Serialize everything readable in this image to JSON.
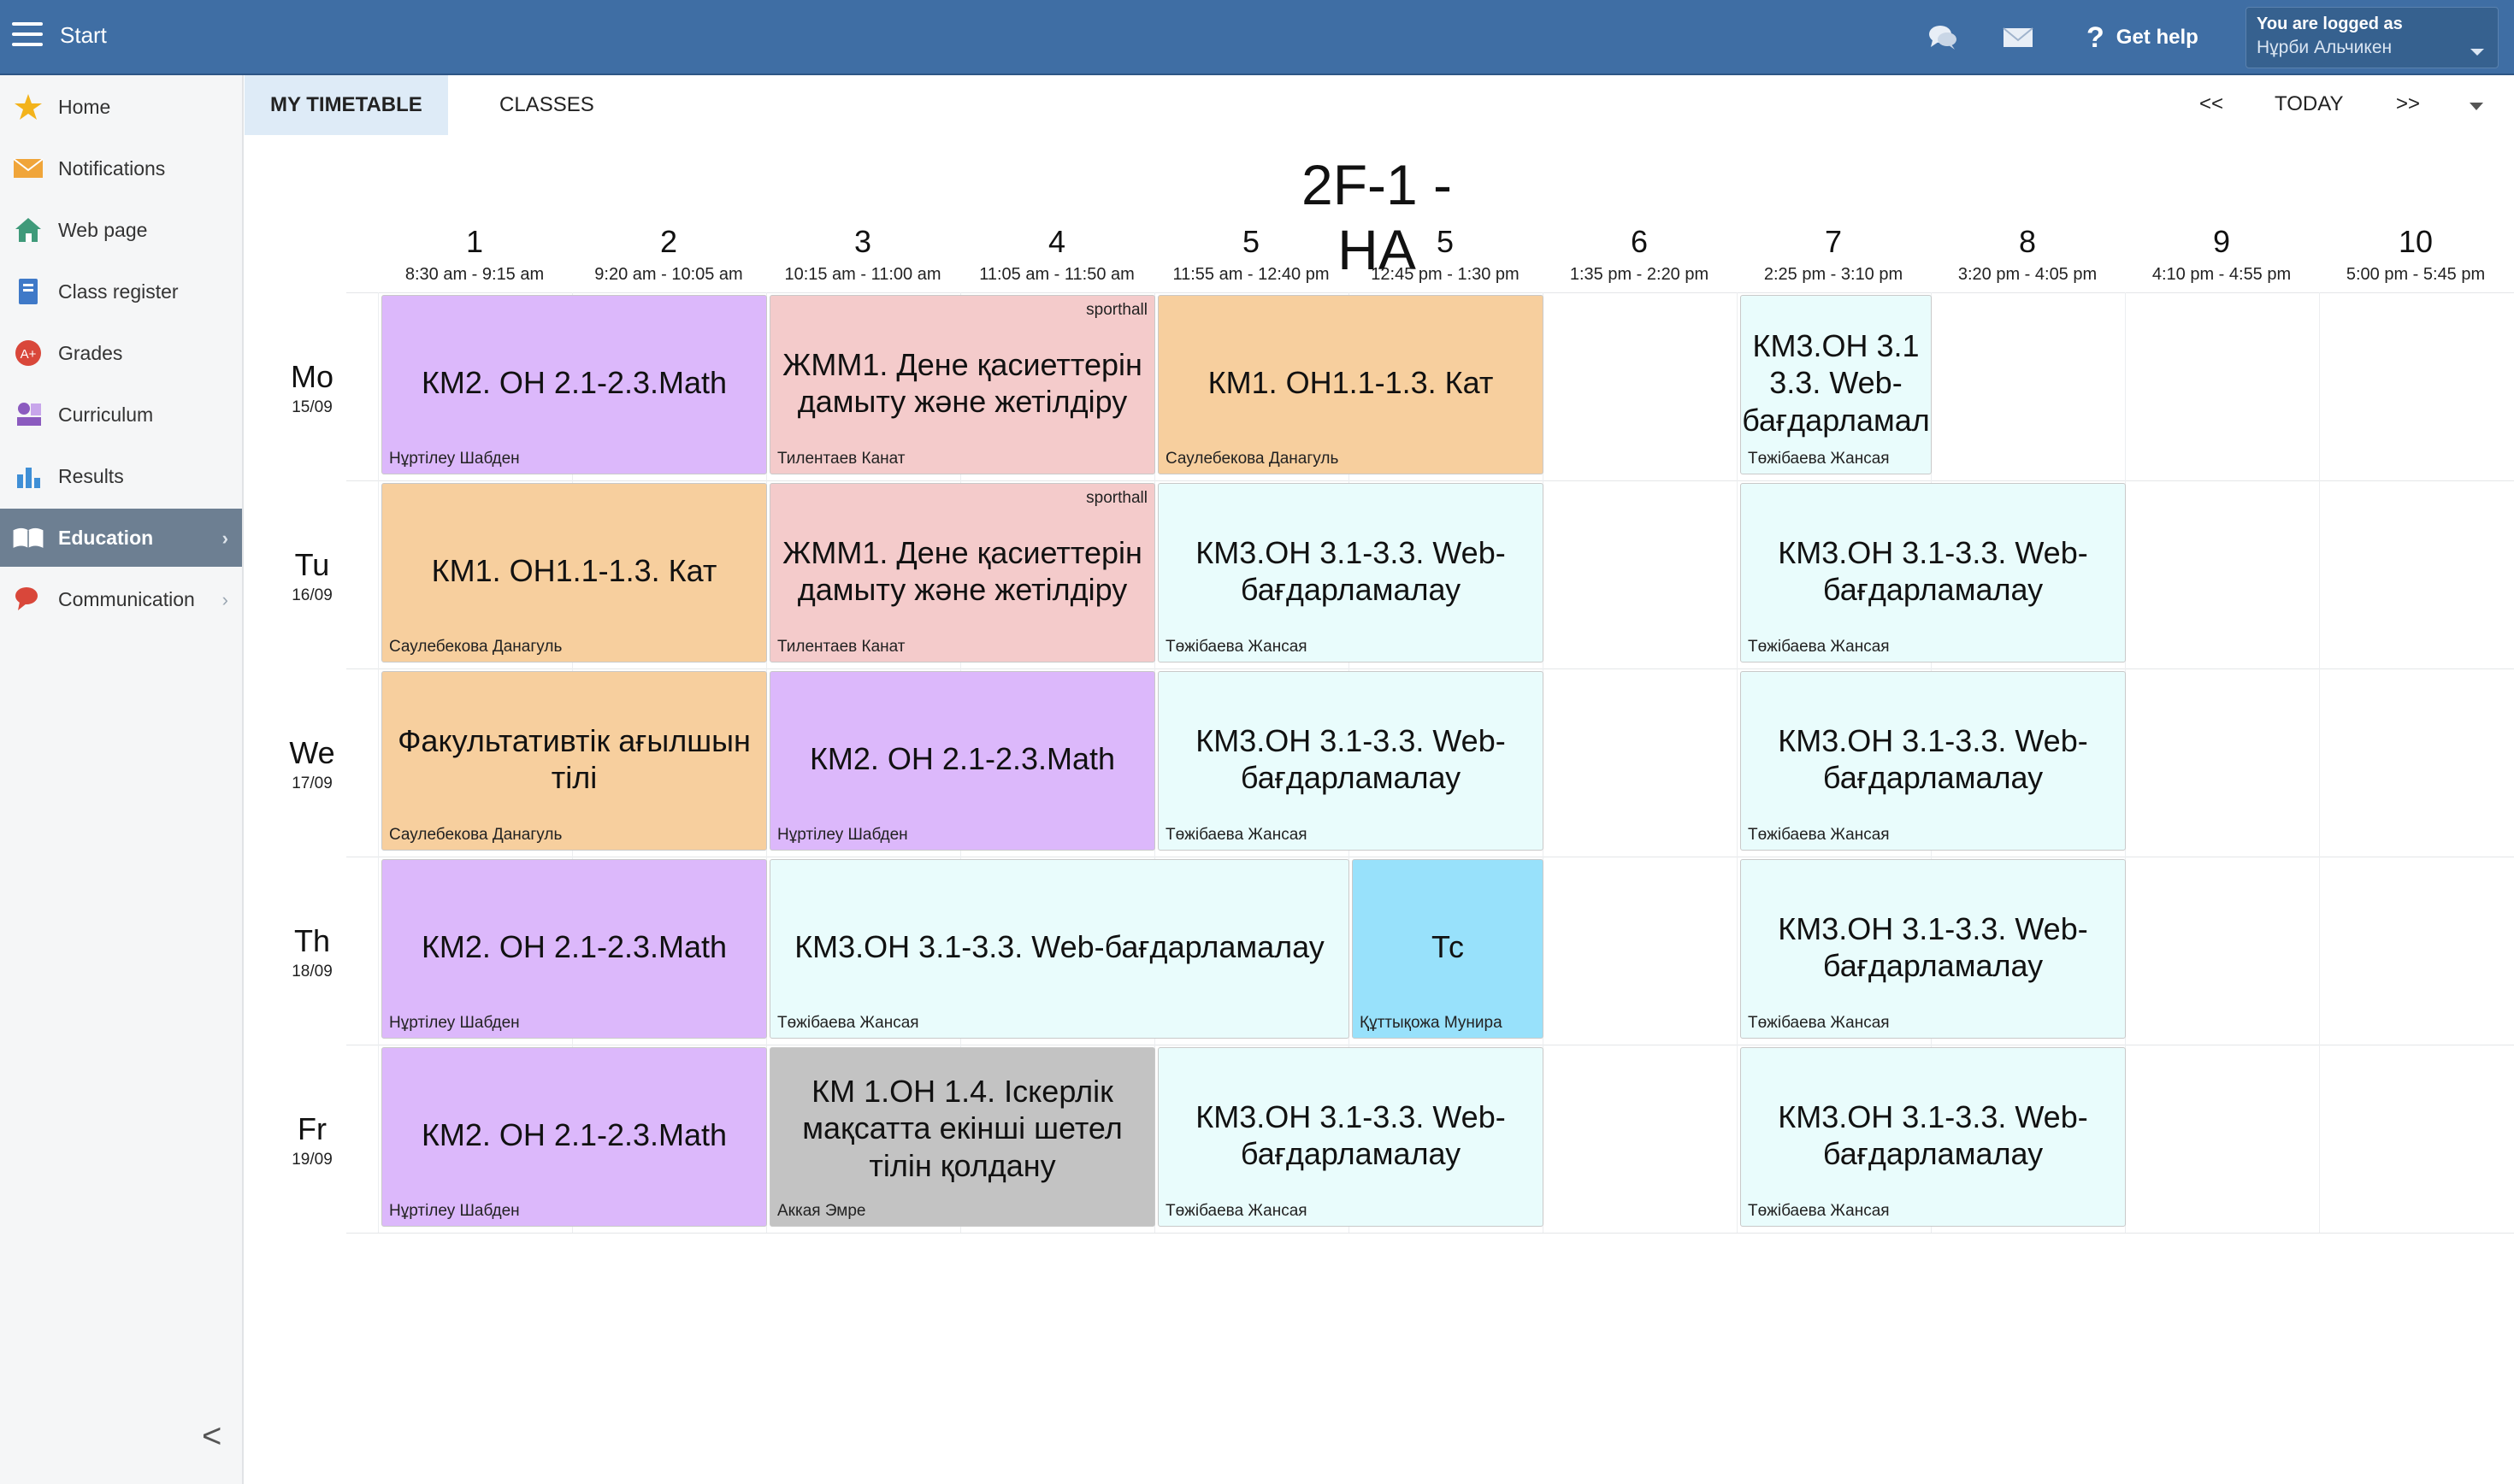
{
  "app": {
    "title": "Start"
  },
  "header": {
    "get_help": "Get help",
    "user_label": "You are logged as",
    "user_name": "Нұрби Альчикен",
    "icons": [
      "chat-icon",
      "mail-icon",
      "help-icon"
    ],
    "accent_color": "#3f6ea4"
  },
  "sidebar": {
    "items": [
      {
        "label": "Home",
        "icon": "star-icon"
      },
      {
        "label": "Notifications",
        "icon": "envelope-icon"
      },
      {
        "label": "Web page",
        "icon": "house-icon"
      },
      {
        "label": "Class register",
        "icon": "register-icon"
      },
      {
        "label": "Grades",
        "icon": "grades-icon"
      },
      {
        "label": "Curriculum",
        "icon": "curriculum-icon"
      },
      {
        "label": "Results",
        "icon": "bar-chart-icon"
      },
      {
        "label": "Education",
        "icon": "book-icon"
      },
      {
        "label": "Communication",
        "icon": "speech-bubble-icon"
      }
    ],
    "active": "Education",
    "collapse_glyph": "<"
  },
  "tabs": [
    {
      "label": "MY TIMETABLE",
      "active": true
    },
    {
      "label": "CLASSES",
      "active": false
    }
  ],
  "nav": {
    "prev": "<<",
    "today": "TODAY",
    "next": ">>"
  },
  "timetable": {
    "title": "2F-1 - HA",
    "periods": [
      {
        "num": "1",
        "time": "8:30 am - 9:15 am"
      },
      {
        "num": "2",
        "time": "9:20 am - 10:05 am"
      },
      {
        "num": "3",
        "time": "10:15 am - 11:00 am"
      },
      {
        "num": "4",
        "time": "11:05 am - 11:50 am"
      },
      {
        "num": "5",
        "time": "11:55 am - 12:40 pm"
      },
      {
        "num": "5",
        "time": "12:45 pm - 1:30 pm"
      },
      {
        "num": "6",
        "time": "1:35 pm - 2:20 pm"
      },
      {
        "num": "7",
        "time": "2:25 pm - 3:10 pm"
      },
      {
        "num": "8",
        "time": "3:20 pm - 4:05 pm"
      },
      {
        "num": "9",
        "time": "4:10 pm - 4:55 pm"
      },
      {
        "num": "10",
        "time": "5:00 pm - 5:45 pm"
      }
    ],
    "days": [
      {
        "day": "Mo",
        "date": "15/09"
      },
      {
        "day": "Tu",
        "date": "16/09"
      },
      {
        "day": "We",
        "date": "17/09"
      },
      {
        "day": "Th",
        "date": "18/09"
      },
      {
        "day": "Fr",
        "date": "19/09"
      }
    ],
    "lessons": [
      {
        "subject": "КМ2. ОН 2.1-2.3.Math",
        "teacher": "Нұртілеу Шабден",
        "room": "",
        "color": "#dcb8fb"
      },
      {
        "subject": "ЖММ1. Дене қасиеттерін дамыту және жетілдіру",
        "teacher": "Тилентаев Канат",
        "room": "sporthall",
        "color": "#f4cbcb"
      },
      {
        "subject": "КМ1. ОН1.1-1.3. Кат",
        "teacher": "Саулебекова Данагуль",
        "room": "",
        "color": "#f7cf9e"
      },
      {
        "subject": "КМ3.ОН 3.1 3.3. Web-бағдарламал",
        "teacher": "Төжібаева Жансая",
        "room": "",
        "color": "#e9fcfc"
      },
      {
        "subject": "КМ1. ОН1.1-1.3. Кат",
        "teacher": "Саулебекова Данагуль",
        "room": "",
        "color": "#f7cf9e"
      },
      {
        "subject": "ЖММ1. Дене қасиеттерін дамыту және жетілдіру",
        "teacher": "Тилентаев Канат",
        "room": "sporthall",
        "color": "#f4cbcb"
      },
      {
        "subject": "КМ3.ОН 3.1-3.3. Web-бағдарламалау",
        "teacher": "Төжібаева Жансая",
        "room": "",
        "color": "#e9fcfc"
      },
      {
        "subject": "КМ3.ОН 3.1-3.3. Web-бағдарламалау",
        "teacher": "Төжібаева Жансая",
        "room": "",
        "color": "#e9fcfc"
      },
      {
        "subject": "Факультативтік ағылшын тілі",
        "teacher": "Саулебекова Данагуль",
        "room": "",
        "color": "#f7cf9e"
      },
      {
        "subject": "КМ2. ОН 2.1-2.3.Math",
        "teacher": "Нұртілеу Шабден",
        "room": "",
        "color": "#dcb8fb"
      },
      {
        "subject": "КМ3.ОН 3.1-3.3. Web-бағдарламалау",
        "teacher": "Төжібаева Жансая",
        "room": "",
        "color": "#e9fcfc"
      },
      {
        "subject": "КМ3.ОН 3.1-3.3. Web-бағдарламалау",
        "teacher": "Төжібаева Жансая",
        "room": "",
        "color": "#e9fcfc"
      },
      {
        "subject": "КМ2. ОН 2.1-2.3.Math",
        "teacher": "Нұртілеу Шабден",
        "room": "",
        "color": "#dcb8fb"
      },
      {
        "subject": "КМ3.ОН 3.1-3.3. Web-бағдарламалау",
        "teacher": "Төжібаева Жансая",
        "room": "",
        "color": "#e9fcfc"
      },
      {
        "subject": "Тс",
        "teacher": "Құттықожа Мунира",
        "room": "",
        "color": "#98e1fb"
      },
      {
        "subject": "КМ3.ОН 3.1-3.3. Web-бағдарламалау",
        "teacher": "Төжібаева Жансая",
        "room": "",
        "color": "#e9fcfc"
      },
      {
        "subject": "КМ2. ОН 2.1-2.3.Math",
        "teacher": "Нұртілеу Шабден",
        "room": "",
        "color": "#dcb8fb"
      },
      {
        "subject": "КМ 1.ОН 1.4. Іскерлік мақсатта екінші шетел тілін қолдану",
        "teacher": "Аккая Эмре",
        "room": "",
        "color": "#c3c3c3"
      },
      {
        "subject": "КМ3.ОН 3.1-3.3. Web-бағдарламалау",
        "teacher": "Төжібаева Жансая",
        "room": "",
        "color": "#e9fcfc"
      },
      {
        "subject": "КМ3.ОН 3.1-3.3. Web-бағдарламалау",
        "teacher": "Төжібаева Жансая",
        "room": "",
        "color": "#e9fcfc"
      }
    ]
  }
}
